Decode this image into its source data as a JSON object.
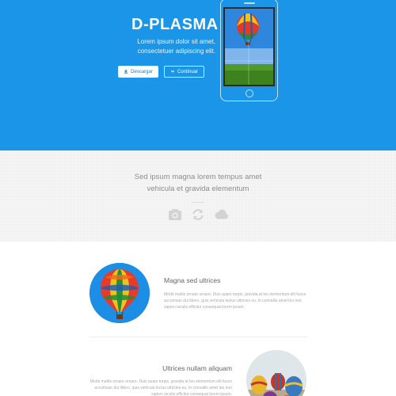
{
  "hero": {
    "title": "D-PLASMA",
    "subtitle": "Lorem ipsum dolor sit amet, consectetuer adipiscing elit.",
    "download_label": "Descargar",
    "continue_label": "Continuar",
    "download_icon": "download-icon",
    "continue_icon": "chevron-down-icon",
    "background_color": "#1a95e8"
  },
  "features": {
    "text": "Sed ipsum magna lorem tempus amet vehicula et gravida elementum",
    "icons": [
      "camera-icon",
      "refresh-icon",
      "cloud-icon"
    ]
  },
  "items": [
    {
      "title": "Magna sed ultrices",
      "text": "Morbi mattis ornare ornare. Duis quam turpis, gravida at leo elementum elit fusce accumsan dui libero, quis vehicula lectus ultricies eu. In convallis amet leo non sapien iaculis efficitur consequat lorem ipsum."
    },
    {
      "title": "Ultrices nullam aliquam",
      "text": "Morbi mattis ornare ornare. Duis quam turpis, gravida at leo elementum elit fusce accumsan dui libero, quis vehicula lectus ultricies eu. In convallis amet leo non sapien iaculis efficitur consequat lorem ipsum."
    }
  ]
}
